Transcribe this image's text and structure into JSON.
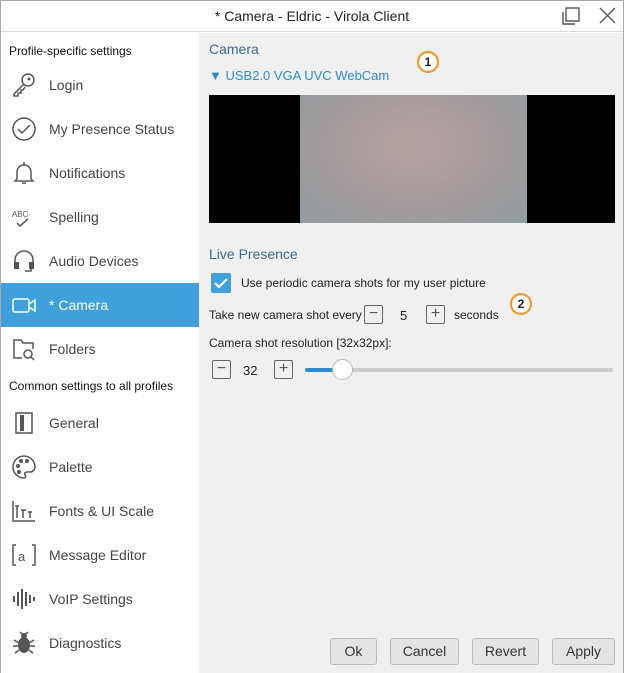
{
  "window": {
    "title": "* Camera - Eldric - Virola Client"
  },
  "sidebar": {
    "section1": "Profile-specific settings",
    "items1": [
      {
        "label": "Login",
        "icon": "key-icon"
      },
      {
        "label": "My Presence Status",
        "icon": "check-circle-icon"
      },
      {
        "label": "Notifications",
        "icon": "bell-icon"
      },
      {
        "label": "Spelling",
        "icon": "spelling-icon"
      },
      {
        "label": "Audio Devices",
        "icon": "headset-icon"
      },
      {
        "label": "* Camera",
        "icon": "camera-icon",
        "selected": true
      },
      {
        "label": "Folders",
        "icon": "folder-search-icon"
      }
    ],
    "section2": "Common settings to all profiles",
    "items2": [
      {
        "label": "General",
        "icon": "general-icon"
      },
      {
        "label": "Palette",
        "icon": "palette-icon"
      },
      {
        "label": "Fonts & UI Scale",
        "icon": "fonts-icon"
      },
      {
        "label": "Message Editor",
        "icon": "message-editor-icon"
      },
      {
        "label": "VoIP Settings",
        "icon": "voip-icon"
      },
      {
        "label": "Diagnostics",
        "icon": "bug-icon"
      }
    ]
  },
  "main": {
    "camera_heading": "Camera",
    "device": "▼ USB2.0 VGA UVC WebCam",
    "badge1": "1",
    "badge2": "2",
    "live_heading": "Live Presence",
    "checkbox_label": "Use periodic camera shots for my user picture",
    "checkbox_checked": true,
    "interval_prefix": "Take new camera shot every",
    "interval_value": "5",
    "interval_suffix": "seconds",
    "resolution_label": "Camera shot resolution [32x32px]:",
    "resolution_value": "32",
    "resolution_slider_fraction": 0.12
  },
  "buttons": {
    "ok": "Ok",
    "cancel": "Cancel",
    "revert": "Revert",
    "apply": "Apply"
  },
  "colors": {
    "accent": "#3fa0dc",
    "heading": "#3a6a93",
    "badge": "#f3941d"
  }
}
